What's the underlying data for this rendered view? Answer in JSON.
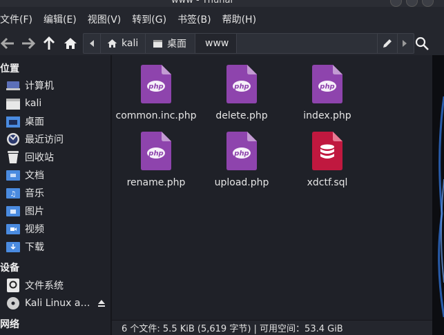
{
  "window": {
    "title": "www - Thunar"
  },
  "menubar": [
    "文件(F)",
    "编辑(E)",
    "视图(V)",
    "转到(G)",
    "书签(B)",
    "帮助(H)"
  ],
  "pathbar": {
    "crumbs": [
      "kali",
      "桌面",
      "www"
    ]
  },
  "sidebar": {
    "places_header": "位置",
    "places": [
      {
        "label": "计算机",
        "icon": "computer-icon"
      },
      {
        "label": "kali",
        "icon": "home-folder-icon"
      },
      {
        "label": "桌面",
        "icon": "desktop-folder-icon"
      },
      {
        "label": "最近访问",
        "icon": "recent-icon"
      },
      {
        "label": "回收站",
        "icon": "trash-icon"
      },
      {
        "label": "文档",
        "icon": "documents-folder-icon"
      },
      {
        "label": "音乐",
        "icon": "music-folder-icon"
      },
      {
        "label": "图片",
        "icon": "pictures-folder-icon"
      },
      {
        "label": "视频",
        "icon": "videos-folder-icon"
      },
      {
        "label": "下载",
        "icon": "downloads-folder-icon"
      }
    ],
    "devices_header": "设备",
    "devices": [
      {
        "label": "文件系统",
        "icon": "filesystem-icon"
      },
      {
        "label": "Kali Linux a…",
        "icon": "disc-icon"
      }
    ],
    "network_header": "网络"
  },
  "files": [
    {
      "name": "common.inc.php",
      "type": "php"
    },
    {
      "name": "delete.php",
      "type": "php"
    },
    {
      "name": "index.php",
      "type": "php"
    },
    {
      "name": "rename.php",
      "type": "php"
    },
    {
      "name": "upload.php",
      "type": "php"
    },
    {
      "name": "xdctf.sql",
      "type": "sql"
    }
  ],
  "statusbar": {
    "text": "6 个文件: 5.5 KiB (5,619 字节) | 可用空间：53.4 GiB"
  },
  "colors": {
    "php": "#8e44ad",
    "sql": "#c0183f",
    "folder_blue": "#4a8be0"
  }
}
